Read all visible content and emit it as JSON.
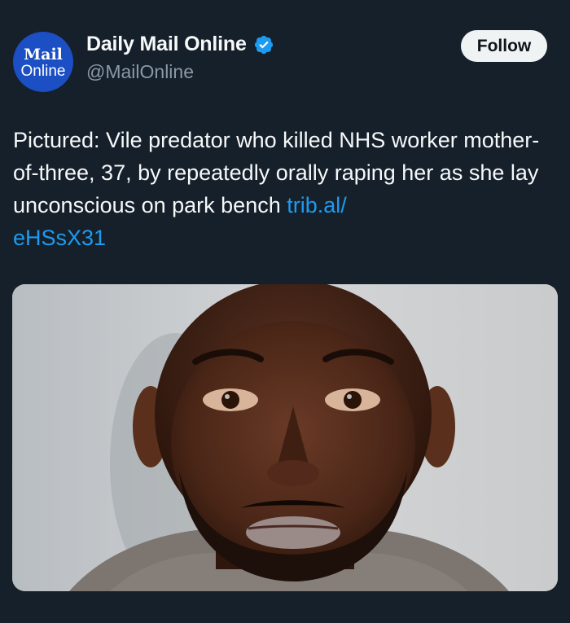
{
  "author": {
    "avatar_text_top": "Mail",
    "avatar_text_bottom": "Online",
    "display_name": "Daily Mail Online",
    "handle": "@MailOnline",
    "verified": true
  },
  "actions": {
    "follow_label": "Follow"
  },
  "tweet": {
    "text": "Pictured: Vile predator who killed NHS worker mother-of-three, 37, by repeatedly orally raping her as she lay unconscious on park bench ",
    "link_text": "trib.al/\neHSsX31"
  },
  "media": {
    "description_name": "mugshot-photo"
  },
  "colors": {
    "background": "#15202b",
    "link": "#1d9bf0",
    "verified_badge": "#1d9bf0",
    "avatar": "#1c4ec4"
  }
}
